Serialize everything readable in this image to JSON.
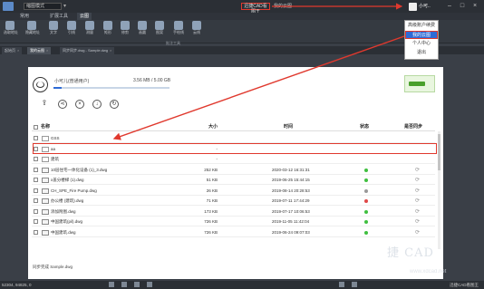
{
  "titlebar": {
    "quick_access": "缩图模式",
    "highlighted": "迅捷CAD看图王",
    "title_suffix": "我的云图",
    "user": "小可..",
    "window_controls": [
      "–",
      "□",
      "×"
    ]
  },
  "menu": {
    "items": [
      "常用",
      "扩展工具",
      "云图"
    ],
    "active_index": 2
  },
  "toolbar": {
    "tools": [
      "选取地址",
      "隐藏地址",
      "文字",
      "引线",
      "测量",
      "矩形",
      "修剪",
      "画圆",
      "图案",
      "手绘线",
      "云线"
    ],
    "group_label": "批注工具"
  },
  "dropdown": {
    "items": [
      "高级账户续费",
      "我的云图",
      "个人中心",
      "退出"
    ],
    "selected_index": 1
  },
  "tabs": [
    {
      "label": "起始页"
    },
    {
      "label": "我的云图"
    },
    {
      "label": "同步同步.dwg - Sample.dwg"
    }
  ],
  "cloud": {
    "user_label": "小可儿(普通用户)",
    "quota_text": "3.56 MB / 5.00 GB",
    "quota_fraction": 0.0007,
    "header": {
      "name": "名称",
      "size": "大小",
      "time": "时间",
      "status": "状态",
      "sync": "是否同步"
    },
    "rows": [
      {
        "name": "GSS",
        "size": "",
        "time": "",
        "status": "",
        "sync": ""
      },
      {
        "name": "aa",
        "size": "-",
        "time": "",
        "status": "",
        "sync": ""
      },
      {
        "name": "建筑",
        "size": "-",
        "time": "",
        "status": "",
        "sync": ""
      },
      {
        "name": "10层住宅一体化设备 (1)_3.dwg",
        "size": "252 KB",
        "time": "2020-03-12 16:31:31",
        "status": "green",
        "sync": "⟳"
      },
      {
        "name": "x盖分楼梯 (1).dwg",
        "size": "51 KB",
        "time": "2019-06-25 15:44:15",
        "status": "green",
        "sync": "⟳"
      },
      {
        "name": "CH_SPE_Fire Pump.dwg",
        "size": "26 KB",
        "time": "2019-08-14 20:28:53",
        "status": "gray",
        "sync": "⟳"
      },
      {
        "name": "办公楼 (建筑).dwg",
        "size": "71 KB",
        "time": "2019-07-11 17:44:29",
        "status": "red",
        "sync": "⟳"
      },
      {
        "name": "添加附图.dwg",
        "size": "173 KB",
        "time": "2019-07-17 10:06:53",
        "status": "green",
        "sync": "⟳"
      },
      {
        "name": "中国建筑(pil).dwg",
        "size": "726 KB",
        "time": "2019-11-05 11:42:04",
        "status": "green",
        "sync": "⟳"
      },
      {
        "name": "中国建筑.dwg",
        "size": "726 KB",
        "time": "2019-06-24 09:07:03",
        "status": "green",
        "sync": "⟳"
      }
    ],
    "footer": "同步完成 Sample.dwg"
  },
  "statusbar": {
    "coords": "52304, 94825, 0",
    "app": "迅捷CAD看图王"
  },
  "watermark": {
    "main": "捷 CAD",
    "url": "www.xdcad.net"
  },
  "colors": {
    "highlight": "#e0392e",
    "accent": "#2e6bd6",
    "ok": "#3fbf3f",
    "warn": "#e04848",
    "neutral": "#999999"
  }
}
